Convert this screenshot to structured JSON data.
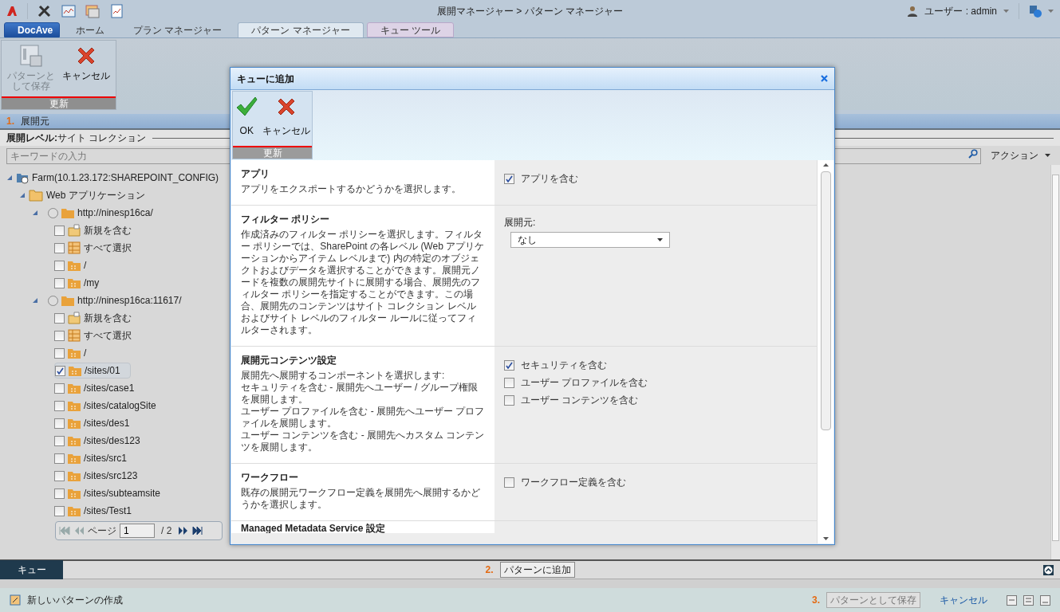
{
  "top_bar": {
    "breadcrumb": "展開マネージャー > パターン マネージャー",
    "user": "ユーザー : admin"
  },
  "tabs": [
    {
      "label": "DocAve",
      "kind": "brand",
      "selected": false
    },
    {
      "label": "ホーム",
      "kind": "tab",
      "selected": false
    },
    {
      "label": "プラン マネージャー",
      "kind": "tab",
      "selected": false
    },
    {
      "label": "パターン マネージャー",
      "kind": "tab",
      "selected": true
    },
    {
      "label": "キュー ツール",
      "kind": "context",
      "selected": false
    }
  ],
  "ribbon": {
    "buttons": [
      {
        "label": "パターンとして保存",
        "kind": "save",
        "disabled": true
      },
      {
        "label": "キャンセル",
        "kind": "cancel",
        "disabled": false
      }
    ],
    "group": "更新"
  },
  "source": {
    "step": "1.",
    "title": "展開元",
    "level_label": "展開レベル:",
    "level_value": "サイト コレクション",
    "search_placeholder": "キーワードの入力",
    "action": "アクション",
    "tree": [
      {
        "label": "Farm(10.1.23.172:SHAREPOINT_CONFIG)",
        "kind": "farm",
        "expanded": true,
        "children": [
          {
            "label": "Web アプリケーション",
            "kind": "webapps",
            "expanded": true,
            "children": [
              {
                "label": "http://ninesp16ca/",
                "kind": "webapp",
                "expanded": true,
                "selected": false,
                "children": [
                  {
                    "label": "新規を含む",
                    "kind": "new",
                    "checked": false
                  },
                  {
                    "label": "すべて選択",
                    "kind": "all",
                    "checked": false
                  },
                  {
                    "label": "/",
                    "kind": "site",
                    "checked": false
                  },
                  {
                    "label": "/my",
                    "kind": "site",
                    "checked": false
                  }
                ]
              },
              {
                "label": "http://ninesp16ca:11617/",
                "kind": "webapp",
                "expanded": true,
                "selected": false,
                "children": [
                  {
                    "label": "新規を含む",
                    "kind": "new",
                    "checked": false
                  },
                  {
                    "label": "すべて選択",
                    "kind": "all",
                    "checked": false
                  },
                  {
                    "label": "/",
                    "kind": "site",
                    "checked": false
                  },
                  {
                    "label": "/sites/01",
                    "kind": "site",
                    "checked": true
                  },
                  {
                    "label": "/sites/case1",
                    "kind": "site",
                    "checked": false
                  },
                  {
                    "label": "/sites/catalogSite",
                    "kind": "site",
                    "checked": false
                  },
                  {
                    "label": "/sites/des1",
                    "kind": "site",
                    "checked": false
                  },
                  {
                    "label": "/sites/des123",
                    "kind": "site",
                    "checked": false
                  },
                  {
                    "label": "/sites/src1",
                    "kind": "site",
                    "checked": false
                  },
                  {
                    "label": "/sites/src123",
                    "kind": "site",
                    "checked": false
                  },
                  {
                    "label": "/sites/subteamsite",
                    "kind": "site",
                    "checked": false
                  },
                  {
                    "label": "/sites/Test1",
                    "kind": "site",
                    "checked": false
                  }
                ]
              }
            ]
          }
        ]
      }
    ],
    "pager": {
      "label": "ページ",
      "value": "1",
      "total": "/ 2"
    }
  },
  "queue_bar": {
    "tab": "キュー",
    "step": "2.",
    "button": "パターンに追加"
  },
  "bottom_bar": {
    "create": "新しいパターンの作成",
    "step": "3.",
    "save": "パターンとして保存",
    "cancel": "キャンセル"
  },
  "dialog": {
    "title": "キューに追加",
    "buttons": [
      {
        "label": "OK",
        "kind": "ok"
      },
      {
        "label": "キャンセル",
        "kind": "cancel"
      }
    ],
    "group": "更新",
    "sections": [
      {
        "title": "アプリ",
        "description": [
          "アプリをエクスポートするかどうかを選択します。"
        ],
        "kind": "checkboxes",
        "options": [
          {
            "label": "アプリを含む",
            "checked": true
          }
        ]
      },
      {
        "title": "フィルター ポリシー",
        "description": [
          "作成済みのフィルター ポリシーを選択します。フィルター ポリシーでは、SharePoint の各レベル (Web アプリケーションからアイテム レベルまで) 内の特定のオブジェクトおよびデータを選択することができます。展開元ノードを複数の展開先サイトに展開する場合、展開先のフィルター ポリシーを指定することができます。この場合、展開先のコンテンツはサイト コレクション レベルおよびサイト レベルのフィルター ルールに従ってフィルターされます。"
        ],
        "kind": "dropdown",
        "field_label": "展開元:",
        "value": "なし"
      },
      {
        "title": "展開元コンテンツ設定",
        "description": [
          "展開先へ展開するコンポーネントを選択します:",
          "セキュリティを含む - 展開先へユーザー / グループ権限を展開します。",
          "ユーザー プロファイルを含む - 展開先へユーザー プロファイルを展開します。",
          "ユーザー コンテンツを含む - 展開先へカスタム コンテンツを展開します。"
        ],
        "kind": "checkboxes",
        "options": [
          {
            "label": "セキュリティを含む",
            "checked": true
          },
          {
            "label": "ユーザー プロファイルを含む",
            "checked": false
          },
          {
            "label": "ユーザー コンテンツを含む",
            "checked": false
          }
        ]
      },
      {
        "title": "ワークフロー",
        "description": [
          "既存の展開元ワークフロー定義を展開先へ展開するかどうかを選択します。"
        ],
        "kind": "checkboxes",
        "options": [
          {
            "label": "ワークフロー定義を含む",
            "checked": false
          }
        ]
      },
      {
        "title": "Managed Metadata Service 設定",
        "kind": "cut"
      }
    ]
  }
}
